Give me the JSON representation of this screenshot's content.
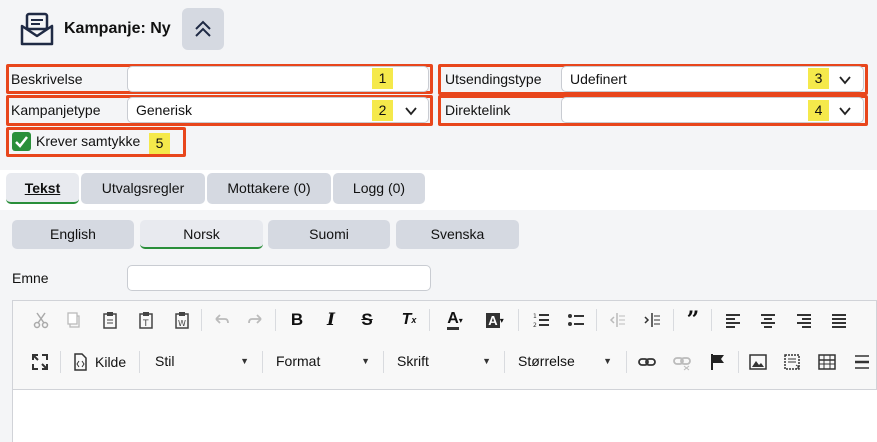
{
  "header": {
    "title": "Kampanje: Ny"
  },
  "form": {
    "beskrivelse_label": "Beskrivelse",
    "beskrivelse_value": "",
    "kampanjetype_label": "Kampanjetype",
    "kampanjetype_value": "Generisk",
    "utsendingstype_label": "Utsendingstype",
    "utsendingstype_value": "Udefinert",
    "direktelink_label": "Direktelink",
    "direktelink_value": "",
    "samtykke_label": "Krever samtykke",
    "samtykke_checked": true
  },
  "badges": [
    "1",
    "2",
    "3",
    "4",
    "5"
  ],
  "tabs": [
    "Tekst",
    "Utvalgsregler",
    "Mottakere (0)",
    "Logg (0)"
  ],
  "languages": [
    "English",
    "Norsk",
    "Suomi",
    "Svenska"
  ],
  "emne": {
    "label": "Emne",
    "value": ""
  },
  "toolbar": {
    "kilde_label": "Kilde",
    "stil_label": "Stil",
    "format_label": "Format",
    "skrift_label": "Skrift",
    "storrelse_label": "Størrelse"
  },
  "colors": {
    "highlight": "#e8461c",
    "badge": "#f5e94b",
    "active_underline": "#2a8f3a",
    "check": "#2a8f3a"
  }
}
